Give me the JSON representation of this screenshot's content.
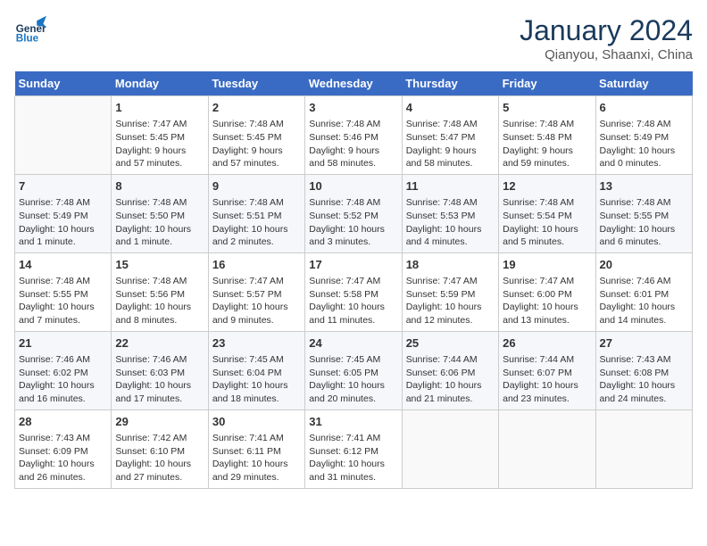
{
  "header": {
    "logo_line1": "General",
    "logo_line2": "Blue",
    "month": "January 2024",
    "location": "Qianyou, Shaanxi, China"
  },
  "weekdays": [
    "Sunday",
    "Monday",
    "Tuesday",
    "Wednesday",
    "Thursday",
    "Friday",
    "Saturday"
  ],
  "weeks": [
    [
      {
        "day": "",
        "info": ""
      },
      {
        "day": "1",
        "info": "Sunrise: 7:47 AM\nSunset: 5:45 PM\nDaylight: 9 hours\nand 57 minutes."
      },
      {
        "day": "2",
        "info": "Sunrise: 7:48 AM\nSunset: 5:45 PM\nDaylight: 9 hours\nand 57 minutes."
      },
      {
        "day": "3",
        "info": "Sunrise: 7:48 AM\nSunset: 5:46 PM\nDaylight: 9 hours\nand 58 minutes."
      },
      {
        "day": "4",
        "info": "Sunrise: 7:48 AM\nSunset: 5:47 PM\nDaylight: 9 hours\nand 58 minutes."
      },
      {
        "day": "5",
        "info": "Sunrise: 7:48 AM\nSunset: 5:48 PM\nDaylight: 9 hours\nand 59 minutes."
      },
      {
        "day": "6",
        "info": "Sunrise: 7:48 AM\nSunset: 5:49 PM\nDaylight: 10 hours\nand 0 minutes."
      }
    ],
    [
      {
        "day": "7",
        "info": "Sunrise: 7:48 AM\nSunset: 5:49 PM\nDaylight: 10 hours\nand 1 minute."
      },
      {
        "day": "8",
        "info": "Sunrise: 7:48 AM\nSunset: 5:50 PM\nDaylight: 10 hours\nand 1 minute."
      },
      {
        "day": "9",
        "info": "Sunrise: 7:48 AM\nSunset: 5:51 PM\nDaylight: 10 hours\nand 2 minutes."
      },
      {
        "day": "10",
        "info": "Sunrise: 7:48 AM\nSunset: 5:52 PM\nDaylight: 10 hours\nand 3 minutes."
      },
      {
        "day": "11",
        "info": "Sunrise: 7:48 AM\nSunset: 5:53 PM\nDaylight: 10 hours\nand 4 minutes."
      },
      {
        "day": "12",
        "info": "Sunrise: 7:48 AM\nSunset: 5:54 PM\nDaylight: 10 hours\nand 5 minutes."
      },
      {
        "day": "13",
        "info": "Sunrise: 7:48 AM\nSunset: 5:55 PM\nDaylight: 10 hours\nand 6 minutes."
      }
    ],
    [
      {
        "day": "14",
        "info": "Sunrise: 7:48 AM\nSunset: 5:55 PM\nDaylight: 10 hours\nand 7 minutes."
      },
      {
        "day": "15",
        "info": "Sunrise: 7:48 AM\nSunset: 5:56 PM\nDaylight: 10 hours\nand 8 minutes."
      },
      {
        "day": "16",
        "info": "Sunrise: 7:47 AM\nSunset: 5:57 PM\nDaylight: 10 hours\nand 9 minutes."
      },
      {
        "day": "17",
        "info": "Sunrise: 7:47 AM\nSunset: 5:58 PM\nDaylight: 10 hours\nand 11 minutes."
      },
      {
        "day": "18",
        "info": "Sunrise: 7:47 AM\nSunset: 5:59 PM\nDaylight: 10 hours\nand 12 minutes."
      },
      {
        "day": "19",
        "info": "Sunrise: 7:47 AM\nSunset: 6:00 PM\nDaylight: 10 hours\nand 13 minutes."
      },
      {
        "day": "20",
        "info": "Sunrise: 7:46 AM\nSunset: 6:01 PM\nDaylight: 10 hours\nand 14 minutes."
      }
    ],
    [
      {
        "day": "21",
        "info": "Sunrise: 7:46 AM\nSunset: 6:02 PM\nDaylight: 10 hours\nand 16 minutes."
      },
      {
        "day": "22",
        "info": "Sunrise: 7:46 AM\nSunset: 6:03 PM\nDaylight: 10 hours\nand 17 minutes."
      },
      {
        "day": "23",
        "info": "Sunrise: 7:45 AM\nSunset: 6:04 PM\nDaylight: 10 hours\nand 18 minutes."
      },
      {
        "day": "24",
        "info": "Sunrise: 7:45 AM\nSunset: 6:05 PM\nDaylight: 10 hours\nand 20 minutes."
      },
      {
        "day": "25",
        "info": "Sunrise: 7:44 AM\nSunset: 6:06 PM\nDaylight: 10 hours\nand 21 minutes."
      },
      {
        "day": "26",
        "info": "Sunrise: 7:44 AM\nSunset: 6:07 PM\nDaylight: 10 hours\nand 23 minutes."
      },
      {
        "day": "27",
        "info": "Sunrise: 7:43 AM\nSunset: 6:08 PM\nDaylight: 10 hours\nand 24 minutes."
      }
    ],
    [
      {
        "day": "28",
        "info": "Sunrise: 7:43 AM\nSunset: 6:09 PM\nDaylight: 10 hours\nand 26 minutes."
      },
      {
        "day": "29",
        "info": "Sunrise: 7:42 AM\nSunset: 6:10 PM\nDaylight: 10 hours\nand 27 minutes."
      },
      {
        "day": "30",
        "info": "Sunrise: 7:41 AM\nSunset: 6:11 PM\nDaylight: 10 hours\nand 29 minutes."
      },
      {
        "day": "31",
        "info": "Sunrise: 7:41 AM\nSunset: 6:12 PM\nDaylight: 10 hours\nand 31 minutes."
      },
      {
        "day": "",
        "info": ""
      },
      {
        "day": "",
        "info": ""
      },
      {
        "day": "",
        "info": ""
      }
    ]
  ]
}
